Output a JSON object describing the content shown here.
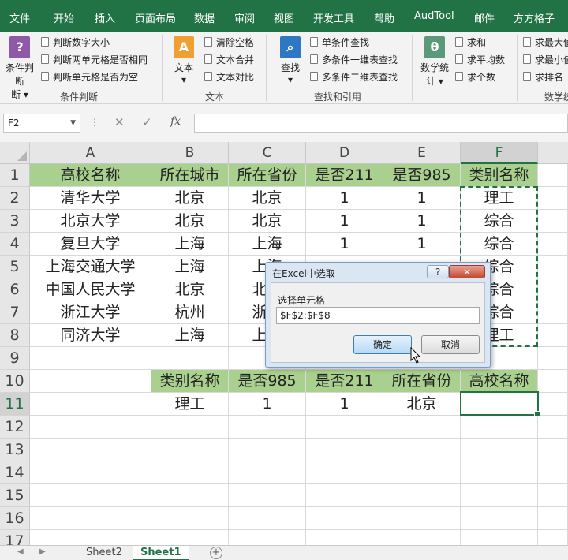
{
  "menubar": {
    "tabs": [
      "文件",
      "开始",
      "插入",
      "页面布局",
      "数据",
      "审阅",
      "视图",
      "开发工具",
      "帮助",
      "AudTool",
      "邮件",
      "方方格子"
    ]
  },
  "ribbon": {
    "groups": {
      "condition": {
        "big_label": "条件判断",
        "big_sub": "断 ▾",
        "items": [
          "判断数字大小",
          "判断两单元格是否相同",
          "判断单元格是否为空"
        ],
        "label": "条件判断"
      },
      "text": {
        "big_label": "文本",
        "big_sub": "▾",
        "items": [
          "清除空格",
          "文本合并",
          "文本对比"
        ],
        "label": "文本"
      },
      "lookup": {
        "big_label": "查找",
        "big_sub": "▾",
        "items": [
          "单条件查找",
          "多条件一维表查找",
          "多条件二维表查找"
        ],
        "label": "查找和引用"
      },
      "stats": {
        "big_label": "数学统",
        "big_sub": "计 ▾",
        "items": [
          "求和",
          "求平均数",
          "求个数"
        ],
        "label": "数学统"
      },
      "more": {
        "items": [
          "求最大值",
          "求最小值",
          "求排名"
        ]
      }
    }
  },
  "formulabar": {
    "namebox": "F2",
    "fx": "fx",
    "formula": ""
  },
  "grid": {
    "columns": [
      "A",
      "B",
      "C",
      "D",
      "E",
      "F"
    ],
    "rows": [
      "1",
      "2",
      "3",
      "4",
      "5",
      "6",
      "7",
      "8",
      "9",
      "10",
      "11",
      "12",
      "13",
      "14",
      "15",
      "16",
      "17"
    ],
    "table1": {
      "headers": [
        "高校名称",
        "所在城市",
        "所在省份",
        "是否211",
        "是否985",
        "类别名称"
      ],
      "rows": [
        [
          "清华大学",
          "北京",
          "北京",
          "1",
          "1",
          "理工"
        ],
        [
          "北京大学",
          "北京",
          "北京",
          "1",
          "1",
          "综合"
        ],
        [
          "复旦大学",
          "上海",
          "上海",
          "1",
          "1",
          "综合"
        ],
        [
          "上海交通大学",
          "上海",
          "上海",
          "",
          "",
          "综合"
        ],
        [
          "中国人民大学",
          "北京",
          "北京",
          "",
          "",
          "综合"
        ],
        [
          "浙江大学",
          "杭州",
          "浙江",
          "",
          "",
          "综合"
        ],
        [
          "同济大学",
          "上海",
          "上海",
          "",
          "",
          "理工"
        ]
      ]
    },
    "table2": {
      "headers": [
        "类别名称",
        "是否985",
        "是否211",
        "所在省份",
        "高校名称"
      ],
      "row": [
        "理工",
        "1",
        "1",
        "北京",
        ""
      ]
    }
  },
  "sheets": {
    "tabs": [
      "Sheet2",
      "Sheet1"
    ],
    "active": "Sheet1",
    "add": "+"
  },
  "dialog": {
    "title": "在Excel中选取",
    "help": "?",
    "close": "✕",
    "label": "选择单元格",
    "value": "$F$2:$F$8",
    "ok": "确定",
    "cancel": "取消"
  },
  "colors": {
    "excel_green": "#217346",
    "header_fill": "#a9d08e"
  }
}
